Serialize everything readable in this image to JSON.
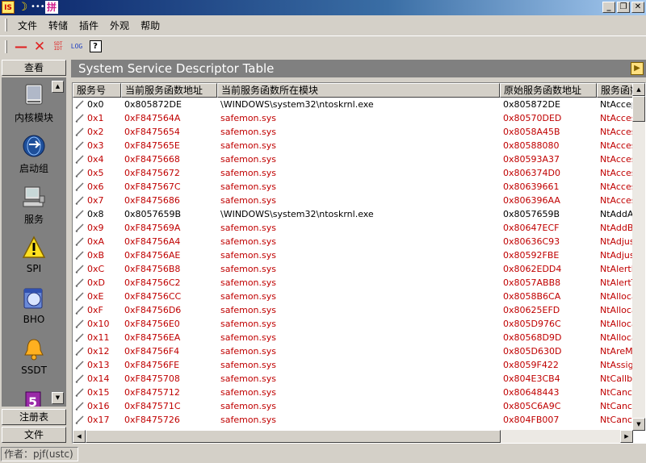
{
  "menu": [
    "文件",
    "转储",
    "插件",
    "外观",
    "帮助"
  ],
  "toolbar": {
    "log_label": "LOG",
    "sdt_label_1": "SDT",
    "sdt_label_2": "IDT",
    "help_label": "?"
  },
  "sidebar": {
    "header": "查看",
    "items": [
      {
        "label": "内核模块",
        "icon": "hard-disk-icon"
      },
      {
        "label": "启动组",
        "icon": "startup-globe-icon"
      },
      {
        "label": "服务",
        "icon": "computer-icon"
      },
      {
        "label": "SPI",
        "icon": "warning-icon"
      },
      {
        "label": "BHO",
        "icon": "browser-icon"
      },
      {
        "label": "SSDT",
        "icon": "bell-icon"
      }
    ],
    "footer": [
      "注册表",
      "文件"
    ]
  },
  "panel": {
    "title": "System Service Descriptor Table"
  },
  "table": {
    "columns": [
      "服务号",
      "当前服务函数地址",
      "当前服务函数所在模块",
      "原始服务函数地址",
      "服务函数"
    ],
    "rows": [
      {
        "id": "0x0",
        "cur": "0x805872DE",
        "module": "\\WINDOWS\\system32\\ntoskrnl.exe",
        "orig": "0x805872DE",
        "name": "NtAccep",
        "hooked": false
      },
      {
        "id": "0x1",
        "cur": "0xF847564A",
        "module": "safemon.sys",
        "orig": "0x80570DED",
        "name": "NtAcces",
        "hooked": true
      },
      {
        "id": "0x2",
        "cur": "0xF8475654",
        "module": "safemon.sys",
        "orig": "0x8058A45B",
        "name": "NtAcces",
        "hooked": true
      },
      {
        "id": "0x3",
        "cur": "0xF847565E",
        "module": "safemon.sys",
        "orig": "0x80588080",
        "name": "NtAcces",
        "hooked": true
      },
      {
        "id": "0x4",
        "cur": "0xF8475668",
        "module": "safemon.sys",
        "orig": "0x80593A37",
        "name": "NtAcces",
        "hooked": true
      },
      {
        "id": "0x5",
        "cur": "0xF8475672",
        "module": "safemon.sys",
        "orig": "0x806374D0",
        "name": "NtAcces",
        "hooked": true
      },
      {
        "id": "0x6",
        "cur": "0xF847567C",
        "module": "safemon.sys",
        "orig": "0x80639661",
        "name": "NtAcces",
        "hooked": true
      },
      {
        "id": "0x7",
        "cur": "0xF8475686",
        "module": "safemon.sys",
        "orig": "0x806396AA",
        "name": "NtAcces",
        "hooked": true
      },
      {
        "id": "0x8",
        "cur": "0x8057659B",
        "module": "\\WINDOWS\\system32\\ntoskrnl.exe",
        "orig": "0x8057659B",
        "name": "NtAddAt",
        "hooked": false
      },
      {
        "id": "0x9",
        "cur": "0xF847569A",
        "module": "safemon.sys",
        "orig": "0x80647ECF",
        "name": "NtAddBo",
        "hooked": true
      },
      {
        "id": "0xA",
        "cur": "0xF84756A4",
        "module": "safemon.sys",
        "orig": "0x80636C93",
        "name": "NtAdjus",
        "hooked": true
      },
      {
        "id": "0xB",
        "cur": "0xF84756AE",
        "module": "safemon.sys",
        "orig": "0x80592FBE",
        "name": "NtAdjus",
        "hooked": true
      },
      {
        "id": "0xC",
        "cur": "0xF84756B8",
        "module": "safemon.sys",
        "orig": "0x8062EDD4",
        "name": "NtAlertR",
        "hooked": true
      },
      {
        "id": "0xD",
        "cur": "0xF84756C2",
        "module": "safemon.sys",
        "orig": "0x8057ABB8",
        "name": "NtAlertT",
        "hooked": true
      },
      {
        "id": "0xE",
        "cur": "0xF84756CC",
        "module": "safemon.sys",
        "orig": "0x8058B6CA",
        "name": "NtAlloca",
        "hooked": true
      },
      {
        "id": "0xF",
        "cur": "0xF84756D6",
        "module": "safemon.sys",
        "orig": "0x80625EFD",
        "name": "NtAlloca",
        "hooked": true
      },
      {
        "id": "0x10",
        "cur": "0xF84756E0",
        "module": "safemon.sys",
        "orig": "0x805D976C",
        "name": "NtAlloca",
        "hooked": true
      },
      {
        "id": "0x11",
        "cur": "0xF84756EA",
        "module": "safemon.sys",
        "orig": "0x80568D9D",
        "name": "NtAlloca",
        "hooked": true
      },
      {
        "id": "0x12",
        "cur": "0xF84756F4",
        "module": "safemon.sys",
        "orig": "0x805D630D",
        "name": "NtAreMa",
        "hooked": true
      },
      {
        "id": "0x13",
        "cur": "0xF84756FE",
        "module": "safemon.sys",
        "orig": "0x8059F422",
        "name": "NtAssign",
        "hooked": true
      },
      {
        "id": "0x14",
        "cur": "0xF8475708",
        "module": "safemon.sys",
        "orig": "0x804E3CB4",
        "name": "NtCallba",
        "hooked": true
      },
      {
        "id": "0x15",
        "cur": "0xF8475712",
        "module": "safemon.sys",
        "orig": "0x80648443",
        "name": "NtCance",
        "hooked": true
      },
      {
        "id": "0x16",
        "cur": "0xF847571C",
        "module": "safemon.sys",
        "orig": "0x805C6A9C",
        "name": "NtCance",
        "hooked": true
      },
      {
        "id": "0x17",
        "cur": "0xF8475726",
        "module": "safemon.sys",
        "orig": "0x804FB007",
        "name": "NtCance",
        "hooked": true
      }
    ]
  },
  "status": {
    "author": "作者：pjf(ustc)"
  },
  "colors": {
    "hooked": "#c00000",
    "normal": "#000000",
    "panel_header": "#808080"
  }
}
